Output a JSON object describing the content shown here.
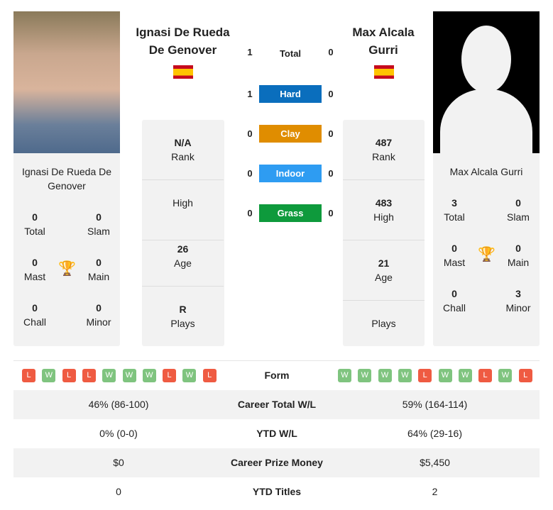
{
  "player1": {
    "name": "Ignasi De Rueda De Genover",
    "name_line1": "Ignasi De Rueda",
    "name_line2": "De Genover",
    "card_line1": "Ignasi De Rueda De",
    "card_line2": "Genover",
    "flag": "spain-flag",
    "total": "0",
    "slam": "0",
    "mast": "0",
    "main": "0",
    "chall": "0",
    "minor": "0",
    "rank": "N/A",
    "high": "",
    "age": "26",
    "plays": "R",
    "form": [
      "L",
      "W",
      "L",
      "L",
      "W",
      "W",
      "W",
      "L",
      "W",
      "L"
    ]
  },
  "player2": {
    "name_line1": "Max Alcala",
    "name_line2": "Gurri",
    "card_name": "Max Alcala Gurri",
    "flag": "spain-flag",
    "total": "3",
    "slam": "0",
    "mast": "0",
    "main": "0",
    "chall": "0",
    "minor": "3",
    "rank": "487",
    "high": "483",
    "age": "21",
    "plays": "",
    "form": [
      "W",
      "W",
      "W",
      "W",
      "L",
      "W",
      "W",
      "L",
      "W",
      "L"
    ]
  },
  "labels": {
    "total": "Total",
    "slam": "Slam",
    "mast": "Mast",
    "main": "Main",
    "chall": "Chall",
    "minor": "Minor",
    "rank": "Rank",
    "high": "High",
    "age": "Age",
    "plays": "Plays"
  },
  "h2h": [
    {
      "label": "Total",
      "p1": "1",
      "p2": "0",
      "color": ""
    },
    {
      "label": "Hard",
      "p1": "1",
      "p2": "0",
      "color": "#0a6ebd"
    },
    {
      "label": "Clay",
      "p1": "0",
      "p2": "0",
      "color": "#e08d00"
    },
    {
      "label": "Indoor",
      "p1": "0",
      "p2": "0",
      "color": "#2e9cf2"
    },
    {
      "label": "Grass",
      "p1": "0",
      "p2": "0",
      "color": "#0e9a3c"
    }
  ],
  "table": [
    {
      "label": "Form"
    },
    {
      "label": "Career Total W/L",
      "p1": "46% (86-100)",
      "p2": "59% (164-114)"
    },
    {
      "label": "YTD W/L",
      "p1": "0% (0-0)",
      "p2": "64% (29-16)"
    },
    {
      "label": "Career Prize Money",
      "p1": "$0",
      "p2": "$5,450"
    },
    {
      "label": "YTD Titles",
      "p1": "0",
      "p2": "2"
    }
  ]
}
